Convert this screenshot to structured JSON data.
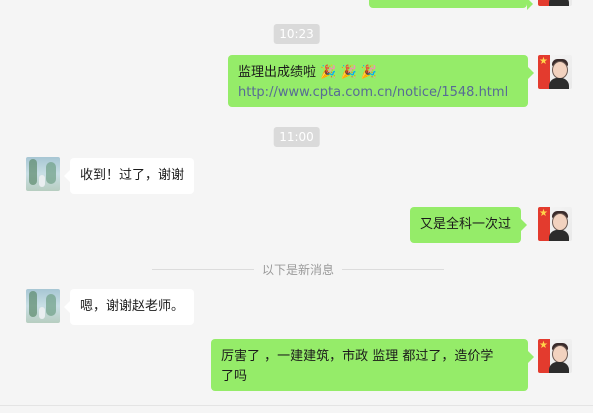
{
  "timestamps": [
    "10:23",
    "11:00"
  ],
  "divider_text": "以下是新消息",
  "messages": [
    {
      "id": "m1",
      "side": "right",
      "sender": "teacher",
      "text_line1": "监理出成绩啦",
      "emoji": [
        "party-popper-icon",
        "party-popper-icon",
        "party-popper-icon"
      ],
      "link": "http://www.cpta.com.cn/notice/1548.html"
    },
    {
      "id": "m2",
      "side": "left",
      "sender": "student",
      "text": "收到！过了，谢谢"
    },
    {
      "id": "m3",
      "side": "right",
      "sender": "teacher",
      "text": "又是全科一次过"
    },
    {
      "id": "m4",
      "side": "left",
      "sender": "student",
      "text": "嗯，谢谢赵老师。"
    },
    {
      "id": "m5",
      "side": "right",
      "sender": "teacher",
      "text_line1": "厉害了 ，一建建筑，市政  监理 都过了，造价学",
      "text_line2": "了吗"
    }
  ],
  "colors": {
    "out_bubble": "#95ec69",
    "in_bubble": "#ffffff",
    "bg": "#f5f5f5",
    "link": "#576b95"
  }
}
